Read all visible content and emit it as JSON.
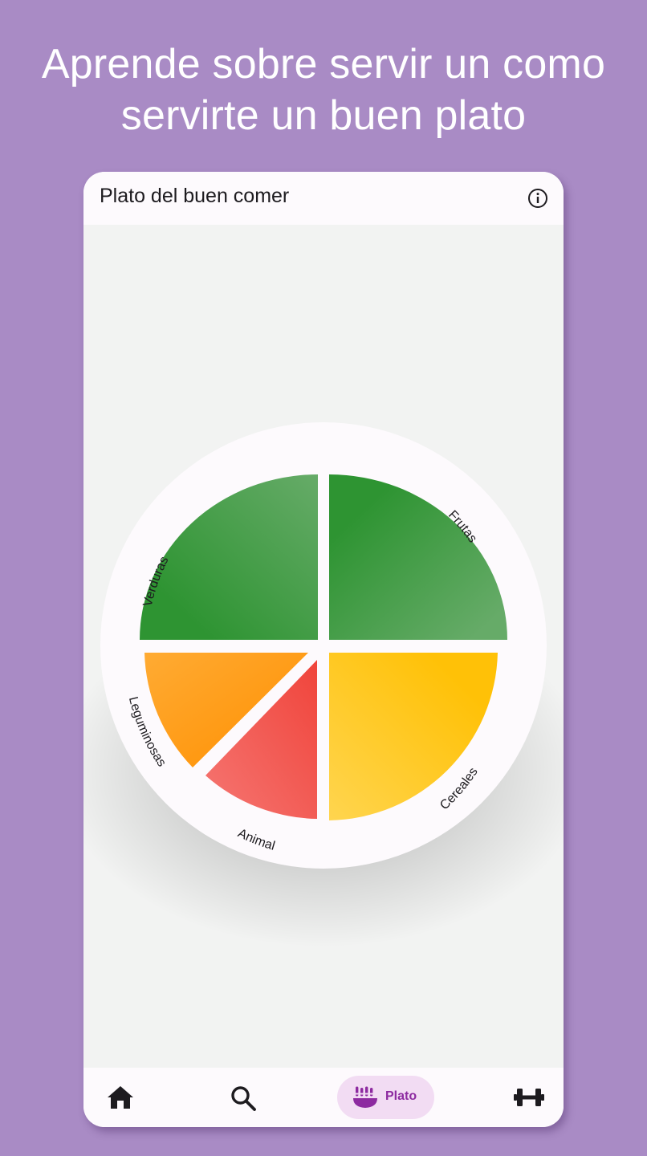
{
  "promo": {
    "line1": "Aprende sobre servir un como",
    "line2": "servirte un buen plato"
  },
  "appbar": {
    "title": "Plato del buen comer",
    "info_icon": "info-icon"
  },
  "plate": {
    "sections": [
      {
        "label": "Verduras",
        "color_start": "#2e9432",
        "color_end": "#66ab68"
      },
      {
        "label": "Frutas",
        "color_start": "#2e9432",
        "color_end": "#66ab68"
      },
      {
        "label": "Leguminosas",
        "color_start": "#ffab33",
        "color_end": "#ff8f00"
      },
      {
        "label": "Animal",
        "color_start": "#f57672",
        "color_end": "#f0443b"
      },
      {
        "label": "Cereales",
        "color_start": "#ffd54f",
        "color_end": "#ffc107"
      }
    ]
  },
  "navbar": {
    "items": [
      {
        "icon": "home-icon"
      },
      {
        "icon": "search-icon"
      },
      {
        "icon": "plate-icon",
        "label": "Plato",
        "selected": true
      },
      {
        "icon": "dumbbell-icon"
      }
    ],
    "accent": "#8d2aa0",
    "pill_color": "#f2dcf3"
  }
}
